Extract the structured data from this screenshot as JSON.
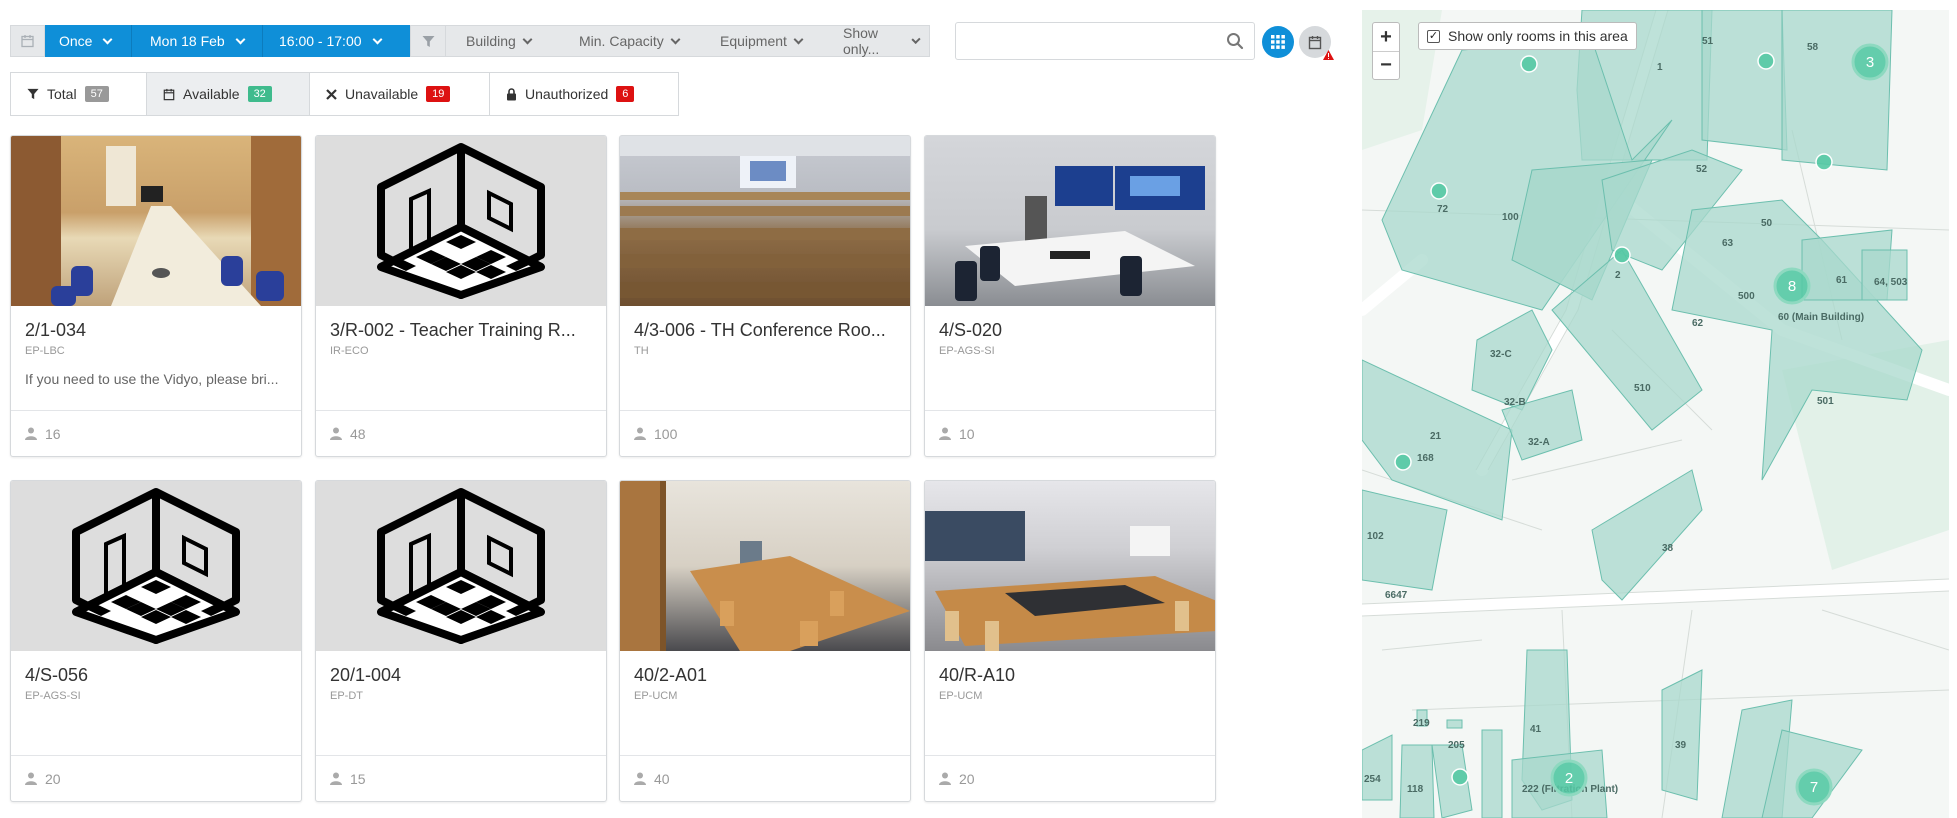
{
  "toolbar": {
    "recurrence": "Once",
    "date": "Mon 18 Feb",
    "time": "16:00 - 17:00"
  },
  "filters": {
    "building": "Building",
    "capacity": "Min. Capacity",
    "equipment": "Equipment",
    "show_only": "Show only..."
  },
  "search": {
    "placeholder": ""
  },
  "stats": [
    {
      "label": "Total",
      "count": "57",
      "color": "#999999"
    },
    {
      "label": "Available",
      "count": "32",
      "color": "#3fbb8d"
    },
    {
      "label": "Unavailable",
      "count": "19",
      "color": "#dd1111"
    },
    {
      "label": "Unauthorized",
      "count": "6",
      "color": "#dd1111"
    }
  ],
  "rooms": [
    {
      "name": "2/1-034",
      "division": "EP-LBC",
      "description": "If you need to use the Vidyo, please bri...",
      "capacity": "16"
    },
    {
      "name": "3/R-002 - Teacher Training R...",
      "division": "IR-ECO",
      "description": "",
      "capacity": "48"
    },
    {
      "name": "4/3-006 - TH Conference Roo...",
      "division": "TH",
      "description": "",
      "capacity": "100"
    },
    {
      "name": "4/S-020",
      "division": "EP-AGS-SI",
      "description": "",
      "capacity": "10"
    },
    {
      "name": "4/S-056",
      "division": "EP-AGS-SI",
      "description": "",
      "capacity": "20"
    },
    {
      "name": "20/1-004",
      "division": "EP-DT",
      "description": "",
      "capacity": "15"
    },
    {
      "name": "40/2-A01",
      "division": "EP-UCM",
      "description": "",
      "capacity": "40"
    },
    {
      "name": "40/R-A10",
      "division": "EP-UCM",
      "description": "",
      "capacity": "20"
    }
  ],
  "map": {
    "zoom_in": "+",
    "zoom_out": "−",
    "show_only_label": "Show only rooms in this area",
    "building_labels": [
      "51",
      "58",
      "1",
      "52",
      "72",
      "100",
      "2",
      "50",
      "63",
      "500",
      "60 (Main Building)",
      "61",
      "64, 503",
      "62",
      "32-C",
      "510",
      "32-B",
      "32-A",
      "501",
      "21",
      "168",
      "102",
      "38",
      "6647",
      "219",
      "205",
      "41",
      "39",
      "254",
      "118",
      "222 (Filtration Plant)"
    ],
    "clusters": [
      "3",
      "8",
      "2",
      "7"
    ],
    "accent": "#55c9a4"
  }
}
